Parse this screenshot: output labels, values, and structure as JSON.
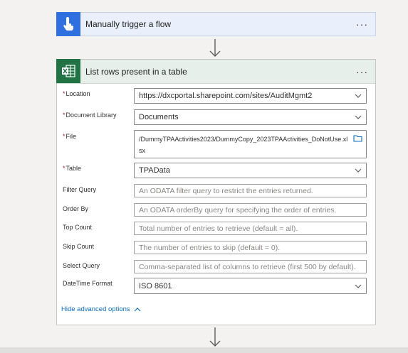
{
  "trigger": {
    "title": "Manually trigger a flow",
    "more": "···"
  },
  "action": {
    "title": "List rows present in a table",
    "more": "···",
    "fields": {
      "location": {
        "label": "Location",
        "required": "*",
        "value": "https://dxcportal.sharepoint.com/sites/AuditMgmt2"
      },
      "library": {
        "label": "Document Library",
        "required": "*",
        "value": "Documents"
      },
      "file": {
        "label": "File",
        "required": "*",
        "value": "/DummyTPAActivities2023/DummyCopy_2023TPAActivities_DoNotUse.xlsx"
      },
      "table": {
        "label": "Table",
        "required": "*",
        "value": "TPAData"
      },
      "filter": {
        "label": "Filter Query",
        "placeholder": "An ODATA filter query to restrict the entries returned."
      },
      "orderby": {
        "label": "Order By",
        "placeholder": "An ODATA orderBy query for specifying the order of entries."
      },
      "top": {
        "label": "Top Count",
        "placeholder": "Total number of entries to retrieve (default = all)."
      },
      "skip": {
        "label": "Skip Count",
        "placeholder": "The number of entries to skip (default = 0)."
      },
      "select": {
        "label": "Select Query",
        "placeholder": "Comma-separated list of columns to retrieve (first 500 by default)."
      },
      "datetime": {
        "label": "DateTime Format",
        "value": "ISO 8601"
      }
    },
    "advanced_link": "Hide advanced options"
  },
  "icons": {
    "trigger": "hand-tap-icon",
    "excel": "excel-icon",
    "chevron": "chevron-down-icon",
    "folder": "folder-icon",
    "arrow": "arrow-down-icon"
  },
  "colors": {
    "trigger_accent": "#2f6fe0",
    "excel_accent": "#217346",
    "link": "#0f6cbd",
    "required": "#a4262c"
  }
}
